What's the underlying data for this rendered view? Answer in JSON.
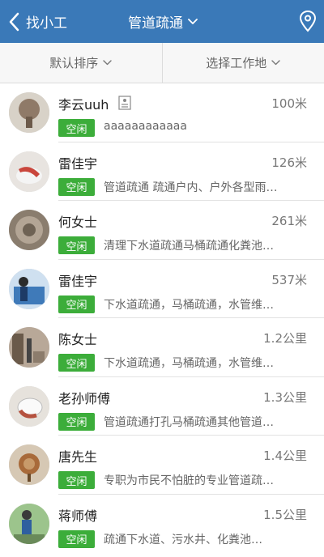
{
  "header": {
    "back_label": "找小工",
    "category": "管道疏通",
    "back_icon": "chevron-left-icon",
    "category_icon": "chevron-down-icon",
    "location_icon": "map-pin-icon",
    "bg_color": "#3a79b8"
  },
  "filters": {
    "sort_label": "默认排序",
    "location_label": "选择工作地"
  },
  "status_color": "#3cad3a",
  "workers": [
    {
      "name": "李云uuh",
      "distance": "100米",
      "status": "空闲",
      "description": "aaaaaaaaaaaa",
      "has_id_card": true,
      "avatar_color": "#8f7a68"
    },
    {
      "name": "雷佳宇",
      "distance": "126米",
      "status": "空闲",
      "description": "管道疏通 疏通户内、户外各型雨…",
      "has_id_card": false,
      "avatar_color": "#c9463c"
    },
    {
      "name": "何女士",
      "distance": "261米",
      "status": "空闲",
      "description": "清理下水道疏通马桶疏通化粪池…",
      "has_id_card": false,
      "avatar_color": "#9c8e7c"
    },
    {
      "name": "雷佳宇",
      "distance": "537米",
      "status": "空闲",
      "description": "下水道疏通，马桶疏通，水管维…",
      "has_id_card": false,
      "avatar_color": "#3f7ab9"
    },
    {
      "name": "陈女士",
      "distance": "1.2公里",
      "status": "空闲",
      "description": "下水道疏通，马桶疏通，水管维…",
      "has_id_card": false,
      "avatar_color": "#6a5a4a"
    },
    {
      "name": "老孙师傅",
      "distance": "1.3公里",
      "status": "空闲",
      "description": "管道疏通打孔马桶疏通其他管道…",
      "has_id_card": false,
      "avatar_color": "#b5523f"
    },
    {
      "name": "唐先生",
      "distance": "1.4公里",
      "status": "空闲",
      "description": "专职为市民不怕脏的专业管道疏…",
      "has_id_card": false,
      "avatar_color": "#a86a3a"
    },
    {
      "name": "蒋师傅",
      "distance": "1.5公里",
      "status": "空闲",
      "description": "疏通下水道、污水井、化粪池…",
      "has_id_card": false,
      "avatar_color": "#4a8a4a"
    }
  ]
}
